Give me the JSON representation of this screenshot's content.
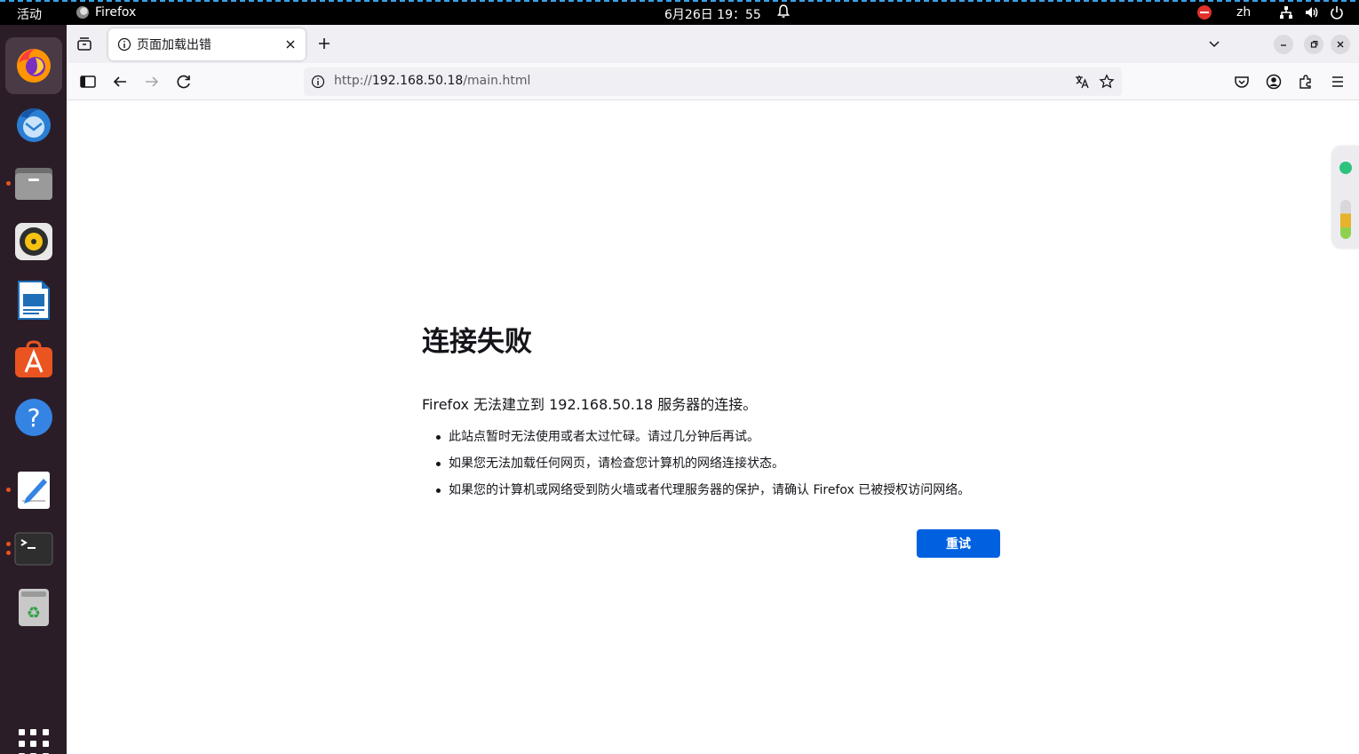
{
  "topbar": {
    "activities": "活动",
    "app_name": "Firefox",
    "clock": "6月26日 19：55",
    "language": "zh"
  },
  "dock": {
    "items": [
      {
        "name": "firefox-icon",
        "color": "#e66000"
      },
      {
        "name": "thunderbird-icon",
        "color": "#2a7fd4"
      },
      {
        "name": "files-icon",
        "color": "#8a8a8a"
      },
      {
        "name": "rhythmbox-icon",
        "color": "#f5c211"
      },
      {
        "name": "writer-icon",
        "color": "#1e6fb8"
      },
      {
        "name": "app-center-icon",
        "color": "#e95420"
      },
      {
        "name": "help-icon",
        "color": "#3584e4"
      },
      {
        "name": "text-editor-icon",
        "color": "#ffffff"
      },
      {
        "name": "terminal-icon",
        "color": "#2e2e2e"
      },
      {
        "name": "trash-icon",
        "color": "#c0c0c0"
      }
    ]
  },
  "browser": {
    "tab_title": "页面加载出错",
    "url_scheme": "http://",
    "url_host": "192.168.50.18",
    "url_path": "/main.html"
  },
  "error": {
    "title": "连接失败",
    "lead": "Firefox 无法建立到 192.168.50.18 服务器的连接。",
    "items": [
      "此站点暂时无法使用或者太过忙碌。请过几分钟后再试。",
      "如果您无法加载任何网页，请检查您计算机的网络连接状态。",
      "如果您的计算机或网络受到防火墙或者代理服务器的保护，请确认 Firefox 已被授权访问网络。"
    ],
    "retry_label": "重试"
  },
  "colors": {
    "accent": "#0061e0",
    "dock_bg": "#2b1d28",
    "running_dot": "#e95420"
  }
}
